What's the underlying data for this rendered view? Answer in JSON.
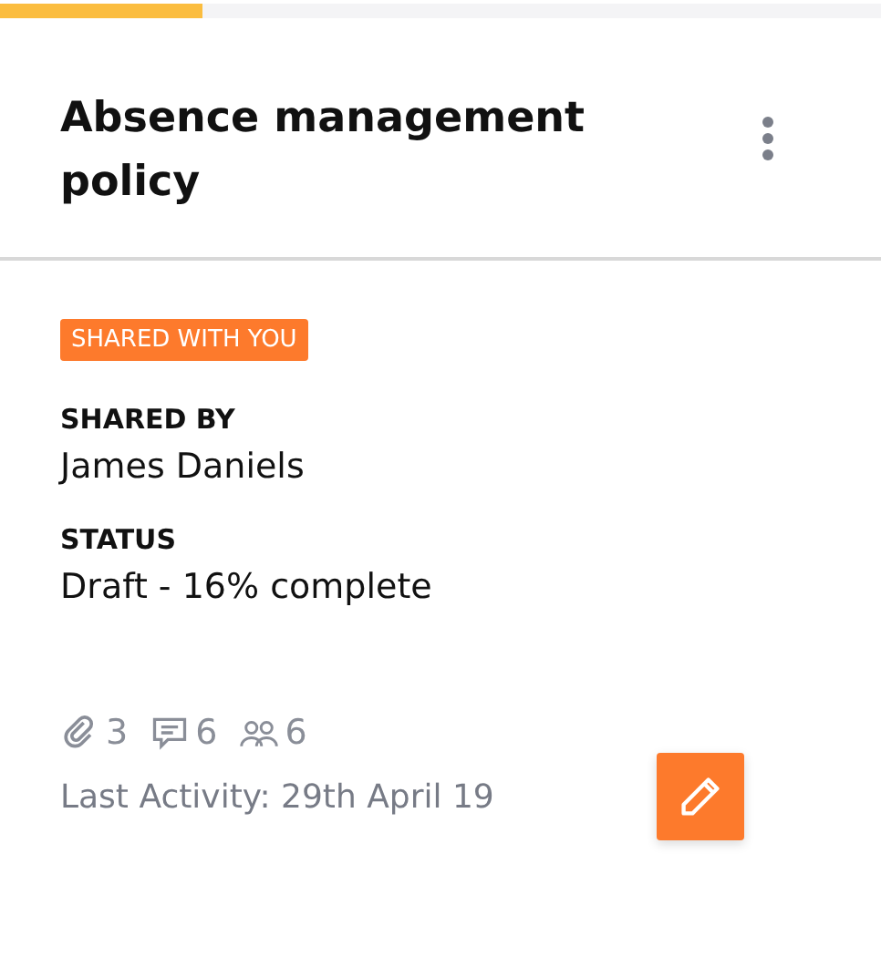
{
  "progress": {
    "level": 0.23
  },
  "title": "Absence management policy",
  "badge": "SHARED WITH YOU",
  "fields": [
    {
      "label": "SHARED BY",
      "value": "James Daniels"
    },
    {
      "label": "STATUS",
      "value": "Draft - 16% complete"
    }
  ],
  "counts": [
    {
      "kind": "attachments",
      "count": "3"
    },
    {
      "kind": "comments",
      "count": "6"
    },
    {
      "kind": "people",
      "count": "6"
    }
  ],
  "last_activity": "Last Activity: 29th April 19"
}
